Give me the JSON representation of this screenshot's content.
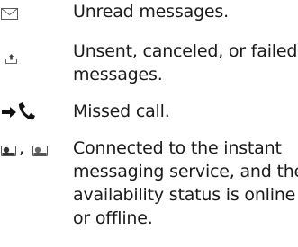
{
  "legend": {
    "items": [
      {
        "icon": "envelope-icon",
        "lines": [
          "Unread messages."
        ]
      },
      {
        "icon": "outbox-upload-icon",
        "lines": [
          "Unsent, canceled, or failed",
          "messages."
        ]
      },
      {
        "icon": "missed-call-icon",
        "lines": [
          "Missed call."
        ]
      },
      {
        "icon": "instant-messaging-status-icons",
        "separator": ",",
        "lines": [
          "Connected to the instant",
          "messaging service, and the",
          "availability status is online",
          "or offline."
        ]
      }
    ]
  }
}
